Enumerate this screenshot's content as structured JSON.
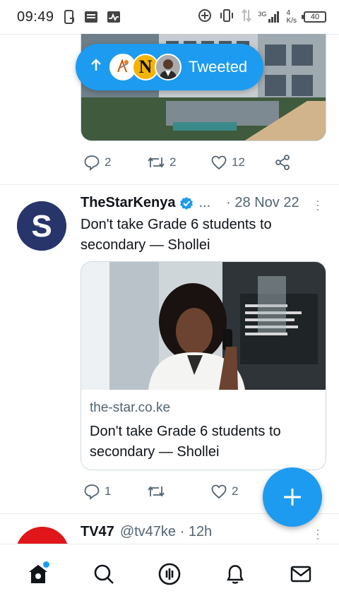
{
  "status_bar": {
    "time": "09:49",
    "network_type": "3G",
    "speed_value": "4",
    "speed_unit": "K/s",
    "battery": "40"
  },
  "tweet1": {
    "replies": "2",
    "retweets": "2",
    "likes": "12"
  },
  "tweeted_pill": {
    "label": "Tweeted",
    "avatar_letter": "N"
  },
  "tweet2": {
    "name": "TheStarKenya",
    "ellipsis": "...",
    "date": "· 28 Nov 22",
    "text": "Don't take Grade 6 students to secondary — Shollei",
    "card_domain": "the-star.co.ke",
    "card_title": "Don't take Grade 6 students to secondary — Shollei",
    "replies": "1",
    "retweets": "",
    "likes": "2",
    "avatar_letter": "S"
  },
  "tweet3": {
    "name": "TV47",
    "handle": "@tv47ke · 12h"
  },
  "colors": {
    "accent": "#1d9bf0",
    "text": "#0f1419",
    "secondary": "#536471"
  }
}
